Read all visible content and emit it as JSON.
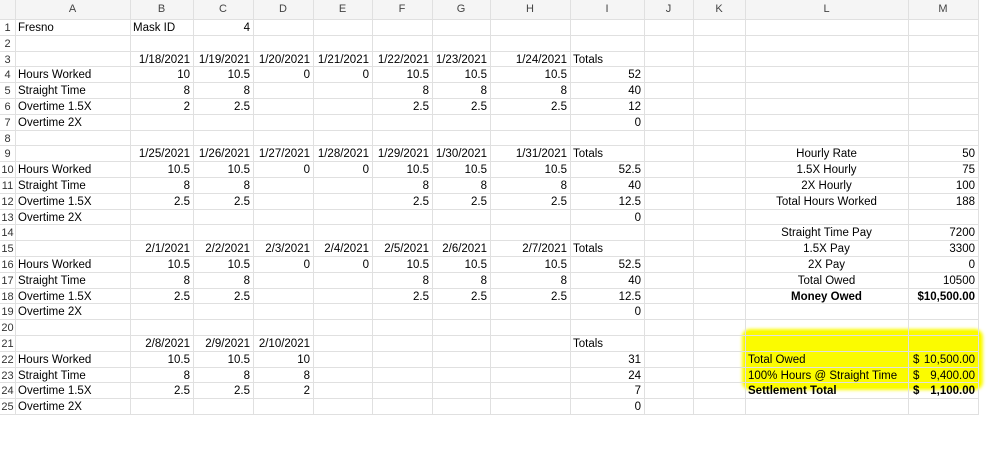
{
  "columns": [
    "A",
    "B",
    "C",
    "D",
    "E",
    "F",
    "G",
    "H",
    "I",
    "J",
    "K",
    "L",
    "M"
  ],
  "rows": [
    "1",
    "2",
    "3",
    "4",
    "5",
    "6",
    "7",
    "8",
    "9",
    "10",
    "11",
    "12",
    "13",
    "14",
    "15",
    "16",
    "17",
    "18",
    "19",
    "20",
    "21",
    "22",
    "23",
    "24",
    "25"
  ],
  "header": {
    "location": "Fresno",
    "mask_label": "Mask ID",
    "mask_value": "4"
  },
  "labels": {
    "hours_worked": "Hours Worked",
    "straight_time": "Straight Time",
    "overtime_15": "Overtime 1.5X",
    "overtime_2": "Overtime 2X",
    "totals": "Totals"
  },
  "weeks": [
    {
      "dates": [
        "1/18/2021",
        "1/19/2021",
        "1/20/2021",
        "1/21/2021",
        "1/22/2021",
        "1/23/2021",
        "1/24/2021"
      ],
      "hours": [
        "10",
        "10.5",
        "0",
        "0",
        "10.5",
        "10.5",
        "10.5"
      ],
      "straight": [
        "8",
        "8",
        "",
        "",
        "8",
        "8",
        "8"
      ],
      "ot15": [
        "2",
        "2.5",
        "",
        "",
        "2.5",
        "2.5",
        "2.5"
      ],
      "totals": [
        "52",
        "40",
        "12",
        "0"
      ]
    },
    {
      "dates": [
        "1/25/2021",
        "1/26/2021",
        "1/27/2021",
        "1/28/2021",
        "1/29/2021",
        "1/30/2021",
        "1/31/2021"
      ],
      "hours": [
        "10.5",
        "10.5",
        "0",
        "0",
        "10.5",
        "10.5",
        "10.5"
      ],
      "straight": [
        "8",
        "8",
        "",
        "",
        "8",
        "8",
        "8"
      ],
      "ot15": [
        "2.5",
        "2.5",
        "",
        "",
        "2.5",
        "2.5",
        "2.5"
      ],
      "totals": [
        "52.5",
        "40",
        "12.5",
        "0"
      ]
    },
    {
      "dates": [
        "2/1/2021",
        "2/2/2021",
        "2/3/2021",
        "2/4/2021",
        "2/5/2021",
        "2/6/2021",
        "2/7/2021"
      ],
      "hours": [
        "10.5",
        "10.5",
        "0",
        "0",
        "10.5",
        "10.5",
        "10.5"
      ],
      "straight": [
        "8",
        "8",
        "",
        "",
        "8",
        "8",
        "8"
      ],
      "ot15": [
        "2.5",
        "2.5",
        "",
        "",
        "2.5",
        "2.5",
        "2.5"
      ],
      "totals": [
        "52.5",
        "40",
        "12.5",
        "0"
      ]
    },
    {
      "dates": [
        "2/8/2021",
        "2/9/2021",
        "2/10/2021",
        "",
        "",
        "",
        ""
      ],
      "hours": [
        "10.5",
        "10.5",
        "10",
        "",
        "",
        "",
        ""
      ],
      "straight": [
        "8",
        "8",
        "8",
        "",
        "",
        "",
        ""
      ],
      "ot15": [
        "2.5",
        "2.5",
        "2",
        "",
        "",
        "",
        ""
      ],
      "totals": [
        "31",
        "24",
        "7",
        "0"
      ]
    }
  ],
  "summary": [
    {
      "label": "Hourly Rate",
      "value": "50",
      "bold": false
    },
    {
      "label": "1.5X Hourly",
      "value": "75",
      "bold": false
    },
    {
      "label": "2X Hourly",
      "value": "100",
      "bold": false
    },
    {
      "label": "Total Hours Worked",
      "value": "188",
      "bold": false
    },
    {
      "label": "",
      "value": "",
      "bold": false
    },
    {
      "label": "Straight Time Pay",
      "value": "7200",
      "bold": false
    },
    {
      "label": "1.5X Pay",
      "value": "3300",
      "bold": false
    },
    {
      "label": "2X Pay",
      "value": "0",
      "bold": false
    },
    {
      "label": "Total Owed",
      "value": "10500",
      "bold": false
    },
    {
      "label": "Money Owed",
      "value": "$10,500.00",
      "bold": true
    }
  ],
  "settlement": [
    {
      "label": "Total Owed",
      "currency": "$",
      "amount": "10,500.00",
      "bold": false
    },
    {
      "label": "100% Hours @ Straight Time",
      "currency": "$",
      "amount": "9,400.00",
      "bold": false
    },
    {
      "label": "Settlement Total",
      "currency": "$",
      "amount": "1,100.00",
      "bold": true
    }
  ],
  "colors": {
    "highlight": "#fbfb00",
    "gridline": "#e0e0e0",
    "header_bg": "#f5f5f5"
  }
}
